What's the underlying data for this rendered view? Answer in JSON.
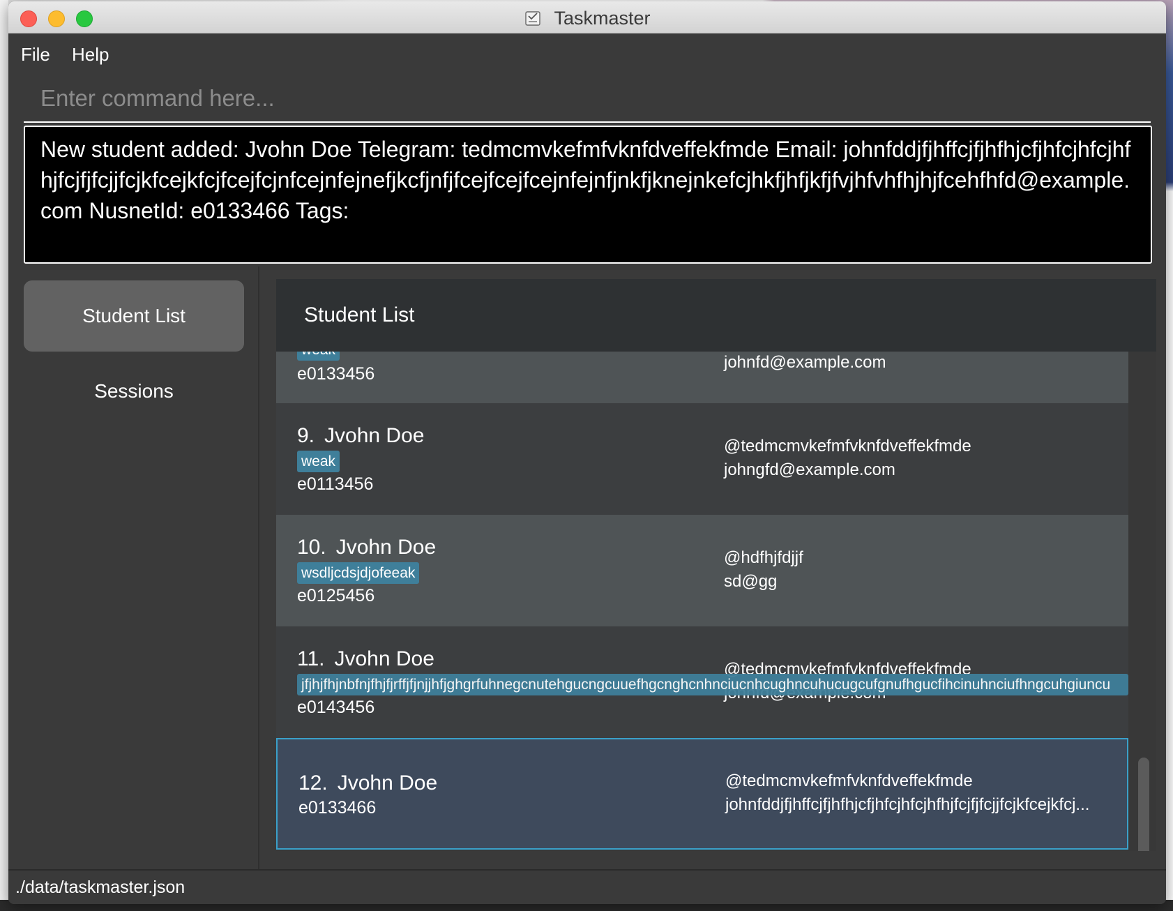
{
  "window": {
    "title": "Taskmaster"
  },
  "menu": {
    "file": "File",
    "help": "Help"
  },
  "command": {
    "placeholder": "Enter command here..."
  },
  "result": {
    "text": "New student added: Jvohn Doe Telegram: tedmcmvkefmfvknfdveffekfmde Email: johnfddjfjhffcjfjhfhjcfjhfcjhfcjhfhjfcjfjfcjjfcjkfcejkfcjfcejfcjnfcejnfejnefjkcfjnfjfcejfcejfcejnfejnfjnkfjknejnkefcjhkfjhfjkfjfvjhfvhfhjhjfcehfhfd@example.com NusnetId: e0133466 Tags:"
  },
  "sidebar": {
    "items": [
      "Student List",
      "Sessions"
    ]
  },
  "list": {
    "header": "Student List",
    "cards": [
      {
        "index": "",
        "name": "",
        "tag": "weak",
        "id": "e0133456",
        "telegram": "",
        "email": "johnfd@example.com"
      },
      {
        "index": "9.",
        "name": "Jvohn Doe",
        "tag": "weak",
        "id": "e0113456",
        "telegram": "@tedmcmvkefmfvknfdveffekfmde",
        "email": "johngfd@example.com"
      },
      {
        "index": "10.",
        "name": "Jvohn Doe",
        "tag": "wsdljcdsjdjofeeak",
        "id": "e0125456",
        "telegram": "@hdfhjfdjjf",
        "email": "sd@gg"
      },
      {
        "index": "11.",
        "name": "Jvohn Doe",
        "tag": "jfjhjfhjnbfnjfhjfjrffjfjnjjhfjghgrfuhnegcnutehgucngcuuefhgcnghcnhnciucnhcughncuhucugcufgnufhgucfihcinuhnciufhngcuhgiuncu",
        "id": "e0143456",
        "telegram": "@tedmcmvkefmfvknfdveffekfmde",
        "email": "johnfd@example.com"
      },
      {
        "index": "12.",
        "name": "Jvohn Doe",
        "tag": "",
        "id": "e0133466",
        "telegram": "@tedmcmvkefmfvknfdveffekfmde",
        "email": "johnfddjfjhffcjfjhfhjcfjhfcjhfcjhfhjfcjfjfcjjfcjkfcejkfcj..."
      }
    ]
  },
  "status": {
    "path": "./data/taskmaster.json"
  },
  "colors": {
    "tag": "#3f7f9a",
    "selected_border": "#3aa0c9",
    "window_bg": "#3a3a3a"
  }
}
